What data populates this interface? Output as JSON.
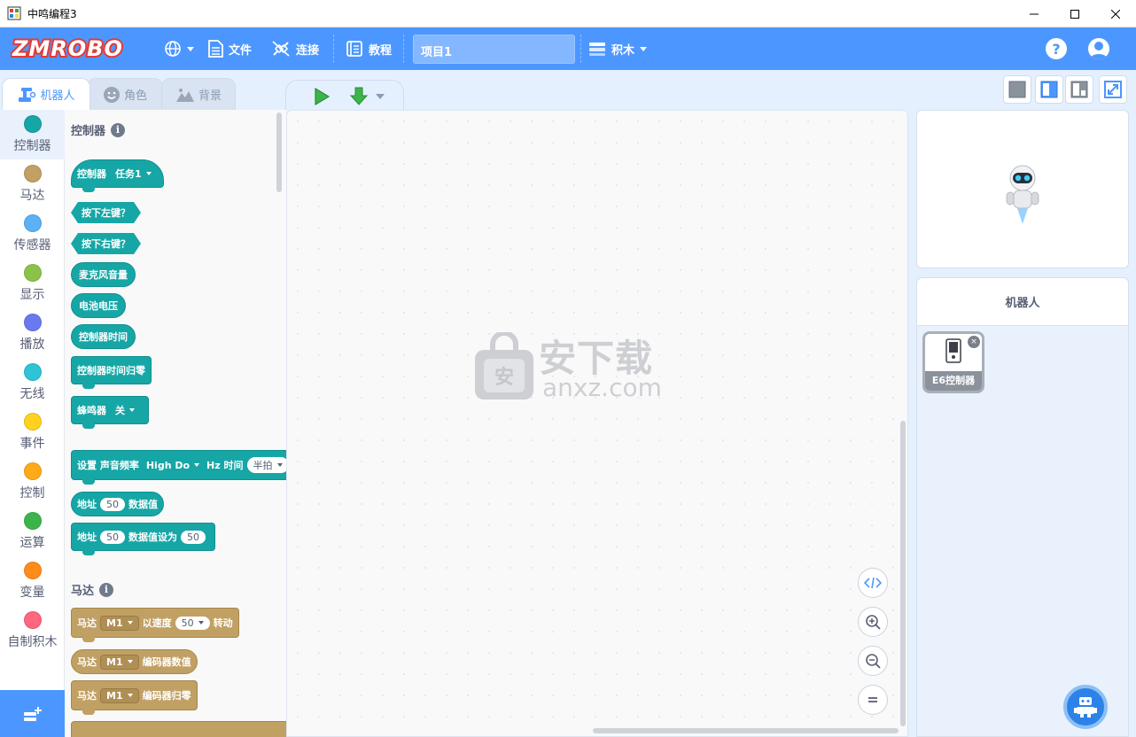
{
  "window": {
    "title": "中鸣编程3",
    "minimize": "—",
    "maximize": "☐",
    "close": "✕"
  },
  "toolbar": {
    "logo": "ZMROBO",
    "file_label": "文件",
    "connect_label": "连接",
    "tutorial_label": "教程",
    "project_name": "项目1",
    "blocks_label": "积木",
    "help": "?"
  },
  "tabs": [
    {
      "label": "机器人",
      "active": true
    },
    {
      "label": "角色",
      "active": false
    },
    {
      "label": "背景",
      "active": false
    }
  ],
  "categories": [
    {
      "label": "控制器",
      "color": "#17a6a6"
    },
    {
      "label": "马达",
      "color": "#c1a064"
    },
    {
      "label": "传感器",
      "color": "#5cb1f5"
    },
    {
      "label": "显示",
      "color": "#8bc34a"
    },
    {
      "label": "播放",
      "color": "#6a79f0"
    },
    {
      "label": "无线",
      "color": "#2ec4d6"
    },
    {
      "label": "事件",
      "color": "#ffd21f"
    },
    {
      "label": "控制",
      "color": "#ffab19"
    },
    {
      "label": "运算",
      "color": "#3bb54a"
    },
    {
      "label": "变量",
      "color": "#ff8c1a"
    },
    {
      "label": "自制积木",
      "color": "#ff6680"
    }
  ],
  "palette": {
    "section_controller": "控制器",
    "section_motor": "马达",
    "info": "i",
    "b_controller_hat": "控制器",
    "b_task": "任务1",
    "b_press_left": "按下左键？",
    "b_press_right": "按下右键？",
    "b_mic": "麦克风音量",
    "b_battery": "电池电压",
    "b_timer": "控制器时间",
    "b_timer_reset": "控制器时间归零",
    "b_buzzer": "蜂鸣器",
    "b_buzzer_state": "关",
    "b_set_freq": "设置 声音频率",
    "b_note": "High Do",
    "b_hz_time": "Hz 时间",
    "b_half_beat": "半拍",
    "b_addr": "地址",
    "b_addr_val": "50",
    "b_data_value": "数据值",
    "b_addr2": "地址",
    "b_addr2_val": "50",
    "b_data_set": "数据值设为",
    "b_data_set_val": "50",
    "b_motor": "马达",
    "b_m1": "M1",
    "b_speed": "以速度",
    "b_speed_val": "50",
    "b_rotate": "转动",
    "b_motor2": "马达",
    "b_m1b": "M1",
    "b_encoder": "编码器数值",
    "b_motor3": "马达",
    "b_m1c": "M1",
    "b_encoder_reset": "编码器归零"
  },
  "watermark": {
    "title": "安下载",
    "sub": "anxz.com",
    "bag_char": "安"
  },
  "robot_panel": {
    "header": "机器人",
    "card_label": "E6控制器",
    "card_close": "×"
  }
}
